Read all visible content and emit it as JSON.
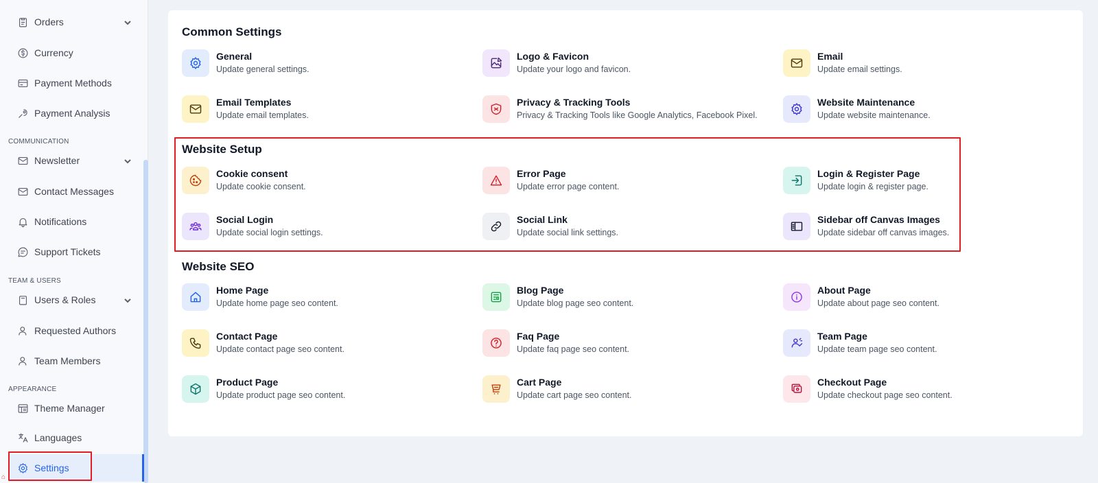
{
  "sidebar": {
    "items": [
      {
        "label": "Orders",
        "icon": "clipboard-icon",
        "has_chevron": true
      },
      {
        "label": "Currency",
        "icon": "currency-icon"
      },
      {
        "label": "Payment Methods",
        "icon": "credit-card-icon"
      },
      {
        "label": "Payment Analysis",
        "icon": "analysis-icon"
      },
      {
        "label": "Newsletter",
        "icon": "mail-icon",
        "has_chevron": true
      },
      {
        "label": "Contact Messages",
        "icon": "mail-open-icon"
      },
      {
        "label": "Notifications",
        "icon": "bell-icon"
      },
      {
        "label": "Support Tickets",
        "icon": "chat-icon"
      },
      {
        "label": "Users & Roles",
        "icon": "user-roles-icon",
        "has_chevron": true
      },
      {
        "label": "Requested Authors",
        "icon": "user-icon"
      },
      {
        "label": "Team Members",
        "icon": "user-icon"
      },
      {
        "label": "Theme Manager",
        "icon": "layout-icon"
      },
      {
        "label": "Languages",
        "icon": "translate-icon"
      },
      {
        "label": "Settings",
        "icon": "gear-icon",
        "active": true
      }
    ],
    "sections": {
      "communication": "COMMUNICATION",
      "team_users": "TEAM & USERS",
      "appearance": "APPEARANCE"
    }
  },
  "sections": {
    "common": {
      "title": "Common Settings",
      "tiles": [
        {
          "title": "General",
          "desc": "Update general settings.",
          "icon": "gear-icon",
          "color": "#2563eb"
        },
        {
          "title": "Logo & Favicon",
          "desc": "Update your logo and favicon.",
          "icon": "image-edit-icon",
          "color": "#4b2a7a"
        },
        {
          "title": "Email",
          "desc": "Update email settings.",
          "icon": "mail-icon",
          "color": "#4b3b0a"
        },
        {
          "title": "Email Templates",
          "desc": "Update email templates.",
          "icon": "mail-icon",
          "color": "#4b3b0a"
        },
        {
          "title": "Privacy & Tracking Tools",
          "desc": "Privacy & Tracking Tools like Google Analytics, Facebook Pixel.",
          "icon": "shield-icon",
          "color": "#d21f2a"
        },
        {
          "title": "Website Maintenance",
          "desc": "Update website maintenance.",
          "icon": "gear-icon",
          "color": "#4338ca"
        }
      ]
    },
    "setup": {
      "title": "Website Setup",
      "tiles": [
        {
          "title": "Cookie consent",
          "desc": "Update cookie consent.",
          "icon": "cookie-icon",
          "color": "#c2410c"
        },
        {
          "title": "Error Page",
          "desc": "Update error page content.",
          "icon": "warning-icon",
          "color": "#d21f2a"
        },
        {
          "title": "Login & Register Page",
          "desc": "Update login & register page.",
          "icon": "login-icon",
          "color": "#0f766e"
        },
        {
          "title": "Social Login",
          "desc": "Update social login settings.",
          "icon": "users-group-icon",
          "color": "#6d28d9"
        },
        {
          "title": "Social Link",
          "desc": "Update social link settings.",
          "icon": "link-icon",
          "color": "#111827"
        },
        {
          "title": "Sidebar off Canvas Images",
          "desc": "Update sidebar off canvas images.",
          "icon": "sidebar-icon",
          "color": "#111827"
        }
      ]
    },
    "seo": {
      "title": "Website SEO",
      "tiles": [
        {
          "title": "Home Page",
          "desc": "Update home page seo content.",
          "icon": "home-icon",
          "color": "#2563eb"
        },
        {
          "title": "Blog Page",
          "desc": "Update blog page seo content.",
          "icon": "news-icon",
          "color": "#16a34a"
        },
        {
          "title": "About Page",
          "desc": "Update about page seo content.",
          "icon": "info-icon",
          "color": "#9333ea"
        },
        {
          "title": "Contact Page",
          "desc": "Update contact page seo content.",
          "icon": "phone-icon",
          "color": "#4b3b0a"
        },
        {
          "title": "Faq Page",
          "desc": "Update faq page seo content.",
          "icon": "question-icon",
          "color": "#d21f2a"
        },
        {
          "title": "Team Page",
          "desc": "Update team page seo content.",
          "icon": "team-icon",
          "color": "#4338ca"
        },
        {
          "title": "Product Page",
          "desc": "Update product page seo content.",
          "icon": "box-icon",
          "color": "#0f766e"
        },
        {
          "title": "Cart Page",
          "desc": "Update cart page seo content.",
          "icon": "cart-icon",
          "color": "#c2410c"
        },
        {
          "title": "Checkout Page",
          "desc": "Update checkout page seo content.",
          "icon": "checkout-icon",
          "color": "#be123c"
        }
      ]
    }
  },
  "colors": {
    "accent": "#2563eb",
    "highlight": "#e01e22"
  }
}
